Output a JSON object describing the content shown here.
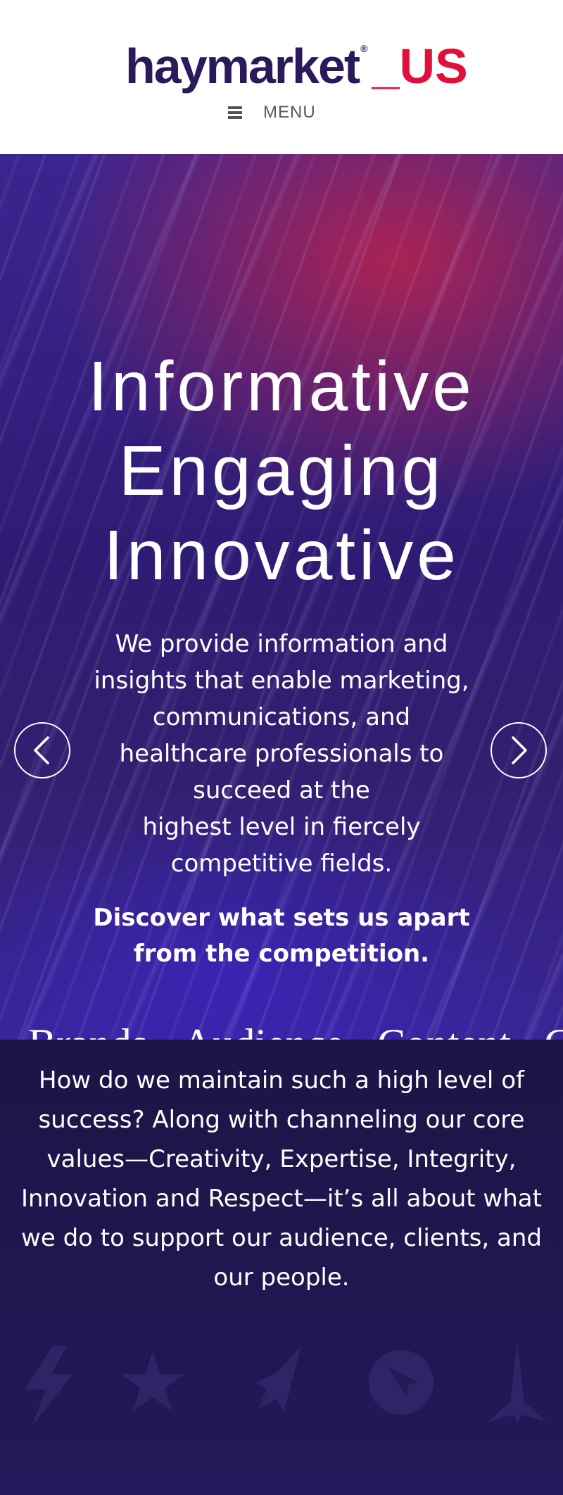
{
  "header": {
    "logo": {
      "main": "haymarket",
      "reg": "®",
      "suffix": "_US"
    },
    "menu_label": "MENU"
  },
  "hero": {
    "words": [
      "Informative",
      "Engaging",
      "Innovative"
    ],
    "description_lines": [
      "We provide information and",
      "insights that enable marketing,",
      "communications, and",
      "healthcare professionals to",
      "succeed at the",
      "highest level in fiercely",
      "competitive fields."
    ],
    "cta_lines": [
      "Discover what sets us apart",
      "from the competition."
    ],
    "tabs": [
      {
        "label": "Brands"
      },
      {
        "label": "Audience"
      },
      {
        "label": "Content"
      },
      {
        "label": "C"
      }
    ]
  },
  "values": {
    "text": "How do we maintain such a high level of success? Along with channeling our core values—Creativity, Expertise, Integrity, Innovation and Respect—it’s all about what we do to support our audience, clients, and our people.",
    "icons": [
      "lightning-icon",
      "star-icon",
      "rocket-icon",
      "compass-icon",
      "tower-icon"
    ]
  },
  "colors": {
    "brand_navy": "#2a1a5c",
    "brand_red": "#e0103a",
    "values_bg": "#1f1347"
  }
}
